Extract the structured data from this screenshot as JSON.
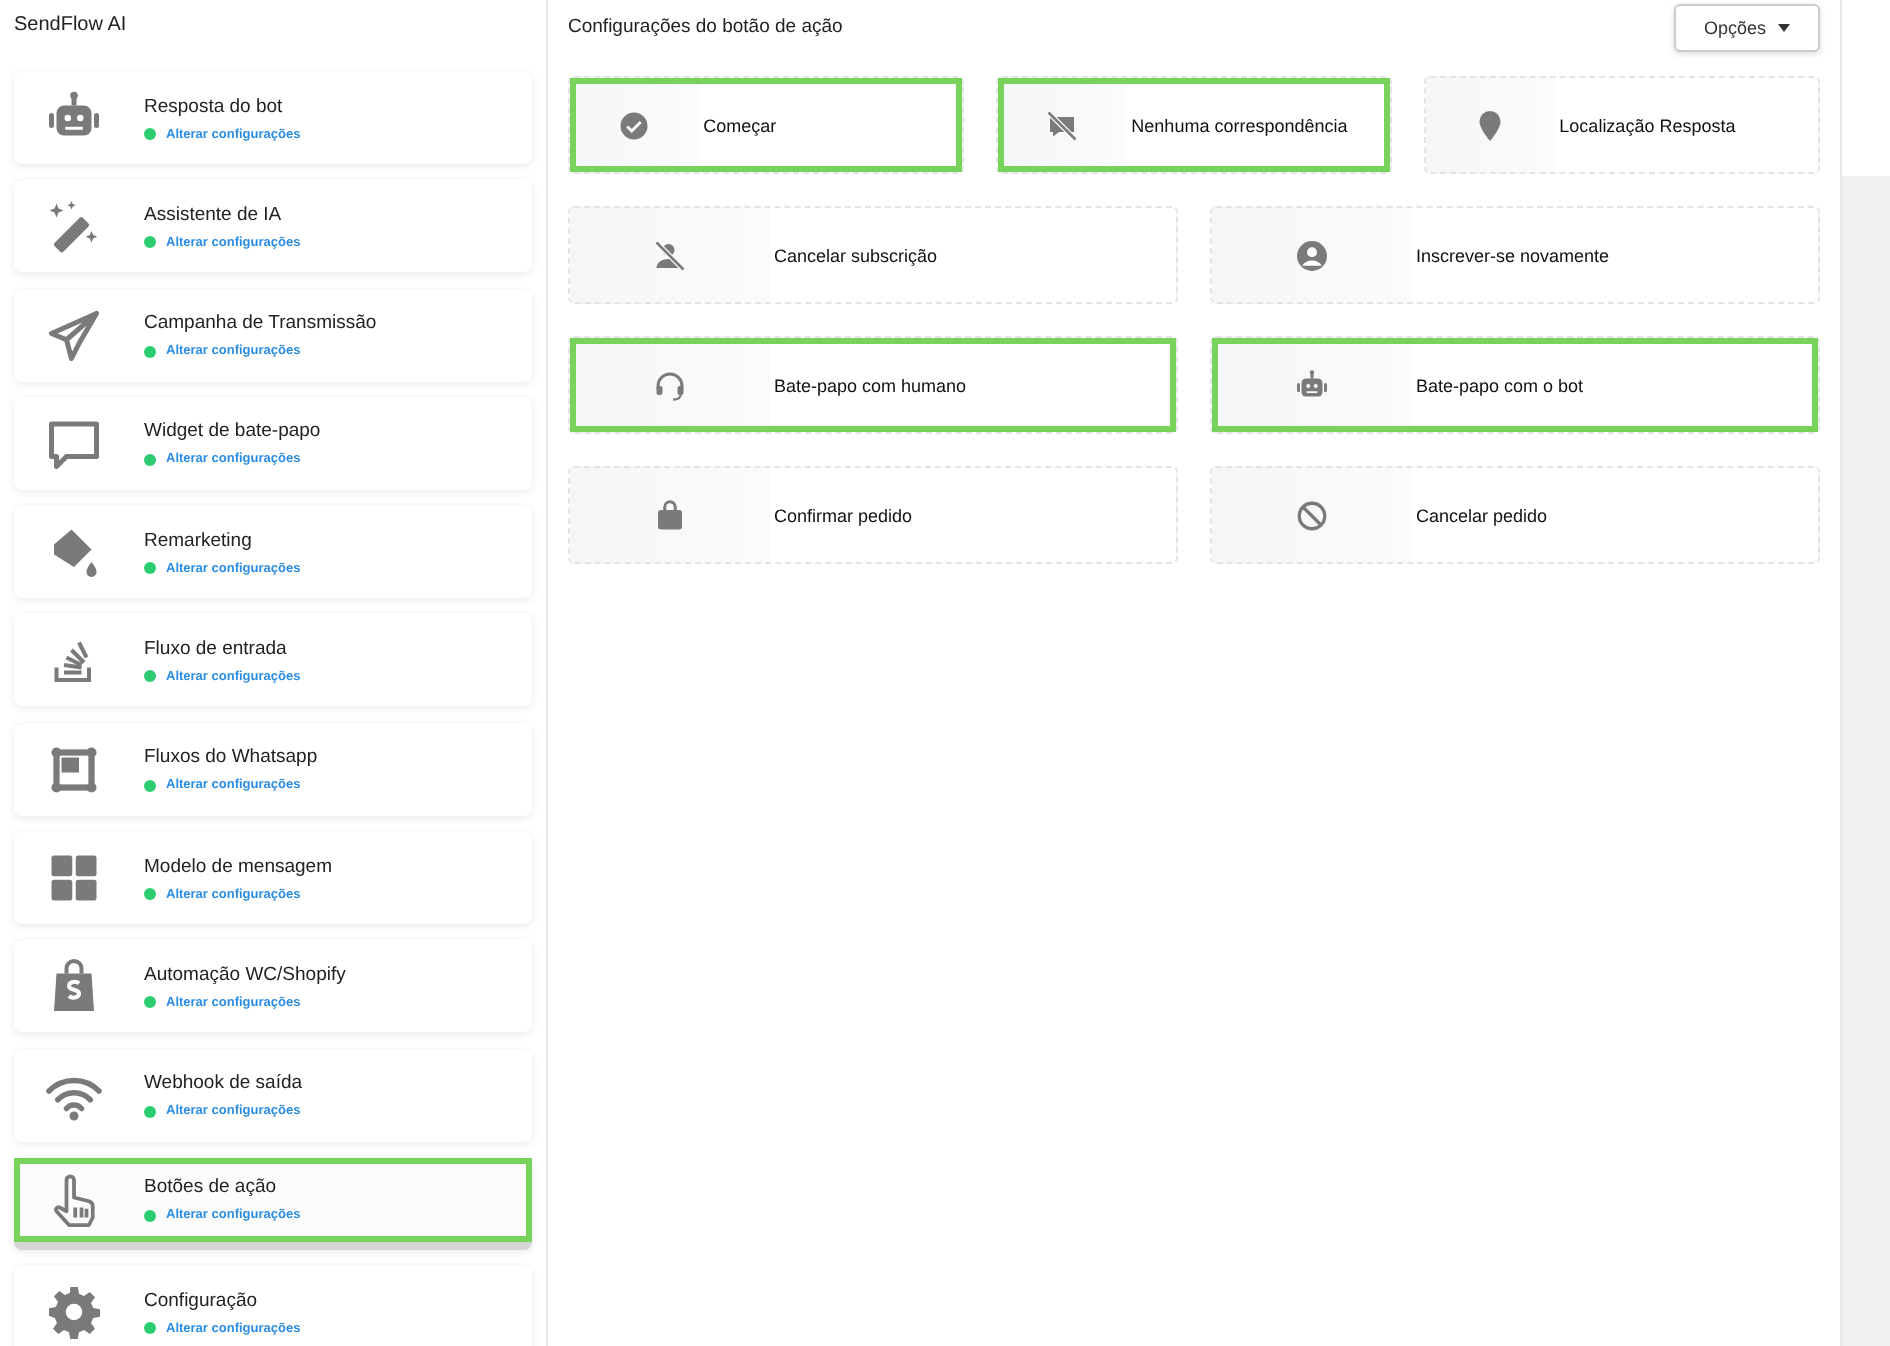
{
  "app": {
    "title": "SendFlow AI"
  },
  "sidebar": {
    "items": [
      {
        "label": "Resposta do bot",
        "link": "Alterar configurações",
        "selected": false,
        "highlighted": false
      },
      {
        "label": "Assistente de IA",
        "link": "Alterar configurações",
        "selected": false,
        "highlighted": false
      },
      {
        "label": "Campanha de Transmissão",
        "link": "Alterar configurações",
        "selected": false,
        "highlighted": false
      },
      {
        "label": "Widget de bate-papo",
        "link": "Alterar configurações",
        "selected": false,
        "highlighted": false
      },
      {
        "label": "Remarketing",
        "link": "Alterar configurações",
        "selected": false,
        "highlighted": false
      },
      {
        "label": "Fluxo de entrada",
        "link": "Alterar configurações",
        "selected": false,
        "highlighted": false
      },
      {
        "label": "Fluxos do Whatsapp",
        "link": "Alterar configurações",
        "selected": false,
        "highlighted": false
      },
      {
        "label": "Modelo de mensagem",
        "link": "Alterar configurações",
        "selected": false,
        "highlighted": false
      },
      {
        "label": "Automação WC/Shopify",
        "link": "Alterar configurações",
        "selected": false,
        "highlighted": false
      },
      {
        "label": "Webhook de saída",
        "link": "Alterar configurações",
        "selected": false,
        "highlighted": false
      },
      {
        "label": "Botões de ação",
        "link": "Alterar configurações",
        "selected": true,
        "highlighted": true
      },
      {
        "label": "Configuração",
        "link": "Alterar configurações",
        "selected": false,
        "highlighted": false
      }
    ]
  },
  "main": {
    "title": "Configurações do botão de ação",
    "options_button": "Opções",
    "rows": [
      {
        "cards": [
          {
            "label": "Começar",
            "highlighted": true
          },
          {
            "label": "Nenhuma correspondência",
            "highlighted": true
          },
          {
            "label": "Localização Resposta",
            "highlighted": false
          }
        ]
      },
      {
        "cards": [
          {
            "label": "Cancelar subscrição",
            "highlighted": false
          },
          {
            "label": "Inscrever-se novamente",
            "highlighted": false
          }
        ]
      },
      {
        "cards": [
          {
            "label": "Bate-papo com humano",
            "highlighted": true
          },
          {
            "label": "Bate-papo com o bot",
            "highlighted": true
          }
        ]
      },
      {
        "cards": [
          {
            "label": "Confirmar pedido",
            "highlighted": false
          },
          {
            "label": "Cancelar pedido",
            "highlighted": false
          }
        ]
      }
    ]
  }
}
